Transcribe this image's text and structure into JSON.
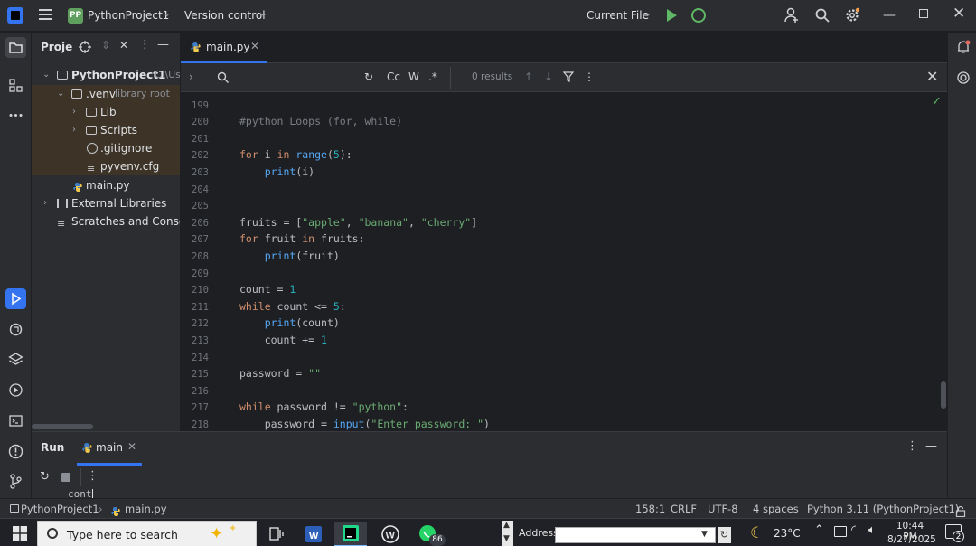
{
  "titlebar": {
    "project_badge": "PP",
    "project_name": "PythonProject1",
    "vcs_label": "Version control",
    "current_file": "Current File"
  },
  "project_panel": {
    "title": "Proje",
    "items": [
      {
        "label": "PythonProject1",
        "extra": "C:\\Us"
      },
      {
        "label": ".venv",
        "extra": "library root"
      },
      {
        "label": "Lib"
      },
      {
        "label": "Scripts"
      },
      {
        "label": ".gitignore"
      },
      {
        "label": "pyvenv.cfg"
      },
      {
        "label": "main.py"
      },
      {
        "label": "External Libraries"
      },
      {
        "label": "Scratches and Consoles"
      }
    ]
  },
  "editor": {
    "tab_label": "main.py",
    "find": {
      "case": "Cc",
      "word": "W",
      "regex": ".*",
      "results": "0 results"
    },
    "line_numbers": [
      "199",
      "200",
      "201",
      "202",
      "203",
      "204",
      "205",
      "206",
      "207",
      "208",
      "209",
      "210",
      "211",
      "212",
      "213",
      "214",
      "215",
      "216",
      "217",
      "218"
    ],
    "code_lines": [
      "",
      "#python Loops (for, while)",
      "",
      "for i in range(5):",
      "    print(i)",
      "",
      "",
      "fruits = [\"apple\", \"banana\", \"cherry\"]",
      "for fruit in fruits:",
      "    print(fruit)",
      "",
      "count = 1",
      "while count <= 5:",
      "    print(count)",
      "    count += 1",
      "",
      "password = \"\"",
      "",
      "while password != \"python\":",
      "    password = input(\"Enter password: \")"
    ]
  },
  "run_panel": {
    "title": "Run",
    "tab_label": "main",
    "output": "cont"
  },
  "statusbar": {
    "breadcrumb_project": "PythonProject1",
    "breadcrumb_file": "main.py",
    "position": "158:1",
    "line_sep": "CRLF",
    "encoding": "UTF-8",
    "indent": "4 spaces",
    "interpreter": "Python 3.11 (PythonProject1)"
  },
  "taskbar": {
    "search_placeholder": "Type here to search",
    "whatsapp_badge": "86",
    "address_label": "Address",
    "temperature": "23°C",
    "time": "10:44 PM",
    "date": "8/27/2025",
    "notification_count": "2"
  }
}
